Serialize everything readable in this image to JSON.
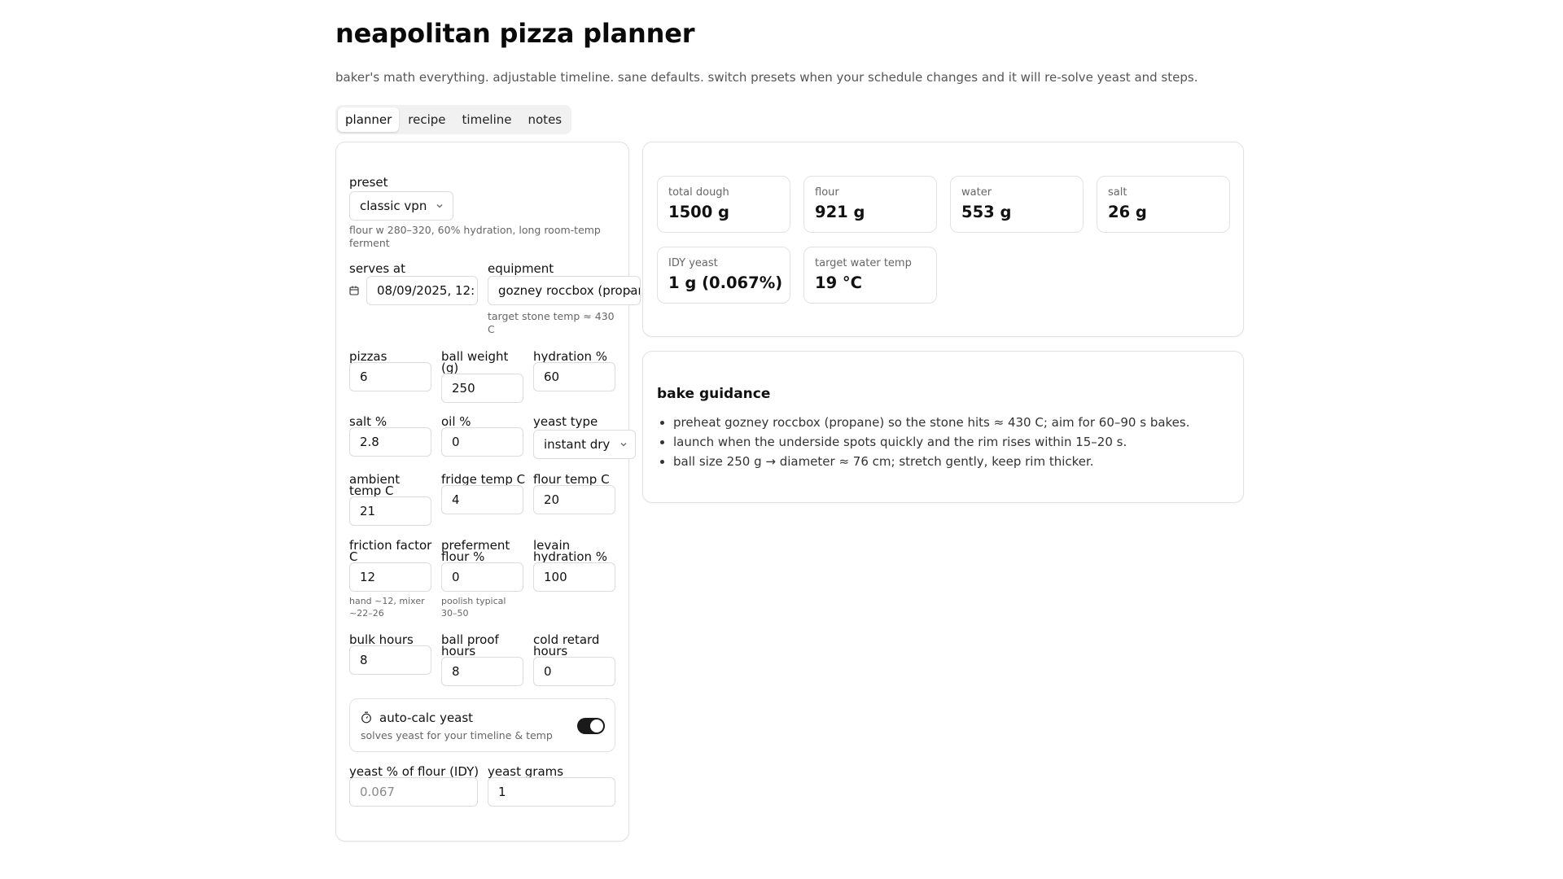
{
  "app": {
    "title": "neapolitan pizza planner",
    "subtitle": "baker's math everything. adjustable timeline. sane defaults. switch presets when your schedule changes and it will re-solve yeast and steps."
  },
  "tabs": [
    {
      "label": "planner",
      "active": true
    },
    {
      "label": "recipe",
      "active": false
    },
    {
      "label": "timeline",
      "active": false
    },
    {
      "label": "notes",
      "active": false
    }
  ],
  "planner": {
    "preset": {
      "label": "preset",
      "value": "classic vpn",
      "hint": "flour w 280–320, 60% hydration, long room-temp ferment"
    },
    "serves_at": {
      "label": "serves at",
      "value": "08/09/2025, 12:"
    },
    "equipment": {
      "label": "equipment",
      "value": "gozney roccbox (propane",
      "hint": "target stone temp ≈ 430 C"
    },
    "pizzas": {
      "label": "pizzas",
      "value": "6"
    },
    "ball_weight": {
      "label": "ball weight (g)",
      "value": "250"
    },
    "hydration": {
      "label": "hydration %",
      "value": "60"
    },
    "salt": {
      "label": "salt %",
      "value": "2.8"
    },
    "oil": {
      "label": "oil %",
      "value": "0"
    },
    "yeast_type": {
      "label": "yeast type",
      "value": "instant dry"
    },
    "ambient_temp": {
      "label": "ambient temp C",
      "value": "21"
    },
    "fridge_temp": {
      "label": "fridge temp C",
      "value": "4"
    },
    "flour_temp": {
      "label": "flour temp C",
      "value": "20"
    },
    "friction": {
      "label": "friction factor C",
      "value": "12",
      "hint": "hand ~12, mixer ~22–26"
    },
    "preferment": {
      "label": "preferment flour %",
      "value": "0",
      "hint": "poolish typical 30–50"
    },
    "levain_hydration": {
      "label": "levain hydration %",
      "value": "100"
    },
    "bulk_hours": {
      "label": "bulk hours",
      "value": "8"
    },
    "ball_proof_hours": {
      "label": "ball proof hours",
      "value": "8"
    },
    "cold_retard_hours": {
      "label": "cold retard hours",
      "value": "0"
    },
    "auto_calc": {
      "title": "auto-calc yeast",
      "subtitle": "solves yeast for your timeline & temp",
      "enabled": true
    },
    "yeast_pct": {
      "label": "yeast % of flour (IDY)",
      "placeholder": "0.067"
    },
    "yeast_grams": {
      "label": "yeast grams",
      "value": "1"
    }
  },
  "stats": [
    {
      "label": "total dough",
      "value": "1500 g"
    },
    {
      "label": "flour",
      "value": "921 g"
    },
    {
      "label": "water",
      "value": "553 g"
    },
    {
      "label": "salt",
      "value": "26 g"
    },
    {
      "label": "IDY yeast",
      "value": "1 g (0.067%)"
    },
    {
      "label": "target water temp",
      "value": "19 °C"
    }
  ],
  "bake": {
    "title": "bake guidance",
    "items": [
      "preheat gozney roccbox (propane) so the stone hits ≈ 430 C; aim for 60–90 s bakes.",
      "launch when the underside spots quickly and the rim rises within 15–20 s.",
      "ball size 250 g → diameter ≈ 76 cm; stretch gently, keep rim thicker."
    ]
  },
  "colors": {
    "accent": "#1a1a1a",
    "border": "#e2e2e2",
    "muted": "#666666"
  },
  "icons": {
    "calendar": "calendar-icon",
    "timer": "timer-icon",
    "chevron": "chevron-down-icon"
  }
}
